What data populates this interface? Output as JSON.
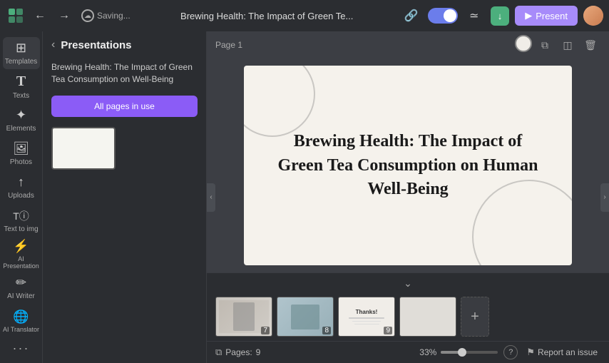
{
  "header": {
    "title": "Brewing Health: The Impact of Green Te...",
    "saving_text": "Saving...",
    "undo_label": "undo",
    "redo_label": "redo",
    "share_label": "share",
    "download_label": "download",
    "present_label": "Present"
  },
  "sidebar": {
    "back_label": "back",
    "panel_title": "Presentations",
    "presentation_name": "Brewing Health: The Impact of Green Tea Consumption on Well-Being",
    "all_pages_label": "All pages in use",
    "items": [
      {
        "id": "templates",
        "label": "Templates",
        "icon": "⊞"
      },
      {
        "id": "texts",
        "label": "Texts",
        "icon": "T"
      },
      {
        "id": "elements",
        "label": "Elements",
        "icon": "✦"
      },
      {
        "id": "photos",
        "label": "Photos",
        "icon": "🖼"
      },
      {
        "id": "uploads",
        "label": "Uploads",
        "icon": "↑"
      },
      {
        "id": "text-to-img",
        "label": "Text to img",
        "icon": "✨"
      },
      {
        "id": "ai-presentation",
        "label": "AI Presentation",
        "icon": "⚡"
      },
      {
        "id": "ai-writer",
        "label": "AI Writer",
        "icon": "✏"
      },
      {
        "id": "ai-translator",
        "label": "AI Translator",
        "icon": "🌐"
      }
    ]
  },
  "canvas": {
    "page_label": "Page 1",
    "slide_title": "Brewing Health: The Impact of Green Tea Consumption on Human Well-Being"
  },
  "filmstrip": {
    "slides": [
      {
        "num": 7,
        "type": "photo"
      },
      {
        "num": 8,
        "type": "photo2"
      },
      {
        "num": 9,
        "type": "thanks"
      },
      {
        "num": "",
        "type": "blank"
      }
    ],
    "add_label": "+"
  },
  "statusbar": {
    "pages_label": "Pages:",
    "pages_count": "9",
    "zoom_pct": "33%",
    "report_label": "Report an issue",
    "help_label": "?"
  }
}
